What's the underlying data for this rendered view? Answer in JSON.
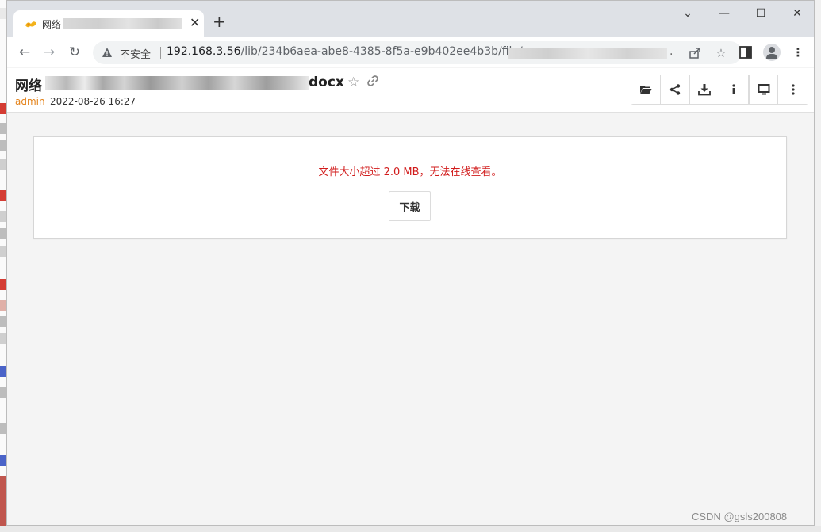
{
  "browser": {
    "tab_title": "网络",
    "tab_close": "✕",
    "new_tab": "+",
    "window_controls": [
      "⌄",
      "—",
      "☐",
      "✕"
    ],
    "security_label": "不安全",
    "url_host": "192.168.3.56",
    "url_path": "/lib/234b6aea-abe8-4385-8f5a-e9b402ee4b3b/file/",
    "url_trailing": "."
  },
  "file": {
    "name_prefix": "网络",
    "name_suffix": "docx",
    "owner": "admin",
    "modified": "2022-08-26 16:27"
  },
  "toolbar_ops": [
    {
      "name": "open-folder-icon"
    },
    {
      "name": "share-icon"
    },
    {
      "name": "download-icon"
    },
    {
      "name": "info-icon"
    },
    {
      "name": "desktop-icon"
    },
    {
      "name": "more-icon"
    }
  ],
  "notice": {
    "message": "文件大小超过 2.0 MB，无法在线查看。",
    "download_label": "下载"
  },
  "watermark": "CSDN @gsls200808",
  "colors": {
    "error_text": "#d11b1b",
    "owner_text": "#e4831b"
  }
}
